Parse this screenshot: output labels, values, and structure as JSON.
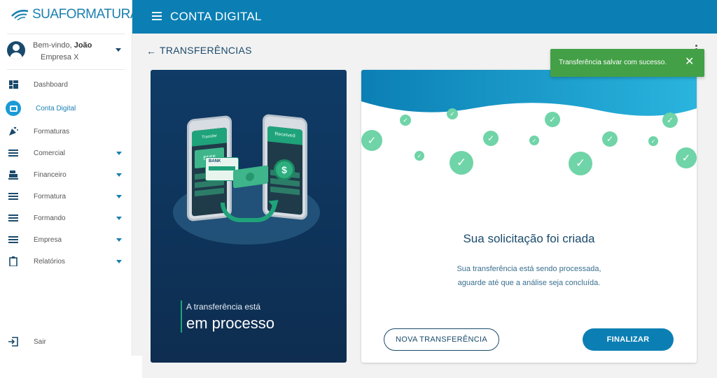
{
  "brand": {
    "name": "SUAFORMATURA",
    "name_part1": "SUA",
    "name_part2": "FORMATURA",
    "color": "#1a7fb0"
  },
  "user": {
    "greeting": "Bem-vindo,",
    "name": "João",
    "company": "Empresa X"
  },
  "sidebar": {
    "items": [
      {
        "label": "Dashboard",
        "icon": "dashboard-icon",
        "has_caret": false,
        "active": false
      },
      {
        "label": "Conta Digital",
        "icon": "wallet-icon",
        "has_caret": false,
        "active": true
      },
      {
        "label": "Formaturas",
        "icon": "party-icon",
        "has_caret": false,
        "active": false
      },
      {
        "label": "Comercial",
        "icon": "menu-icon",
        "has_caret": true,
        "active": false
      },
      {
        "label": "Financeiro",
        "icon": "cash-register-icon",
        "has_caret": true,
        "active": false
      },
      {
        "label": "Formatura",
        "icon": "menu-icon",
        "has_caret": true,
        "active": false
      },
      {
        "label": "Formando",
        "icon": "menu-icon",
        "has_caret": true,
        "active": false
      },
      {
        "label": "Empresa",
        "icon": "menu-icon",
        "has_caret": true,
        "active": false
      },
      {
        "label": "Relatórios",
        "icon": "clipboard-icon",
        "has_caret": true,
        "active": false
      }
    ],
    "logout": {
      "label": "Sair",
      "icon": "logout-icon"
    }
  },
  "header": {
    "title": "CONTA DIGITAL",
    "color": "#0b7fb4"
  },
  "page": {
    "title": "TRANSFERÊNCIAS"
  },
  "illustration": {
    "phone_left_label": "Transfer Completed",
    "phone_right_label": "Received",
    "amount_label": "$$$$",
    "bank_label": "BANK",
    "coin_symbol": "$",
    "caption_small": "A transferência está",
    "caption_big": "em processo"
  },
  "result": {
    "title": "Sua solicitação foi criada",
    "text_line1": "Sua transferência está sendo processada,",
    "text_line2": "aguarde até que a análise seja concluída.",
    "btn_new": "NOVA TRANSFERÊNCIA",
    "btn_finish": "FINALIZAR"
  },
  "toast": {
    "message": "Transferência salvar com sucesso.",
    "close_symbol": "✕",
    "color": "#43a047"
  }
}
